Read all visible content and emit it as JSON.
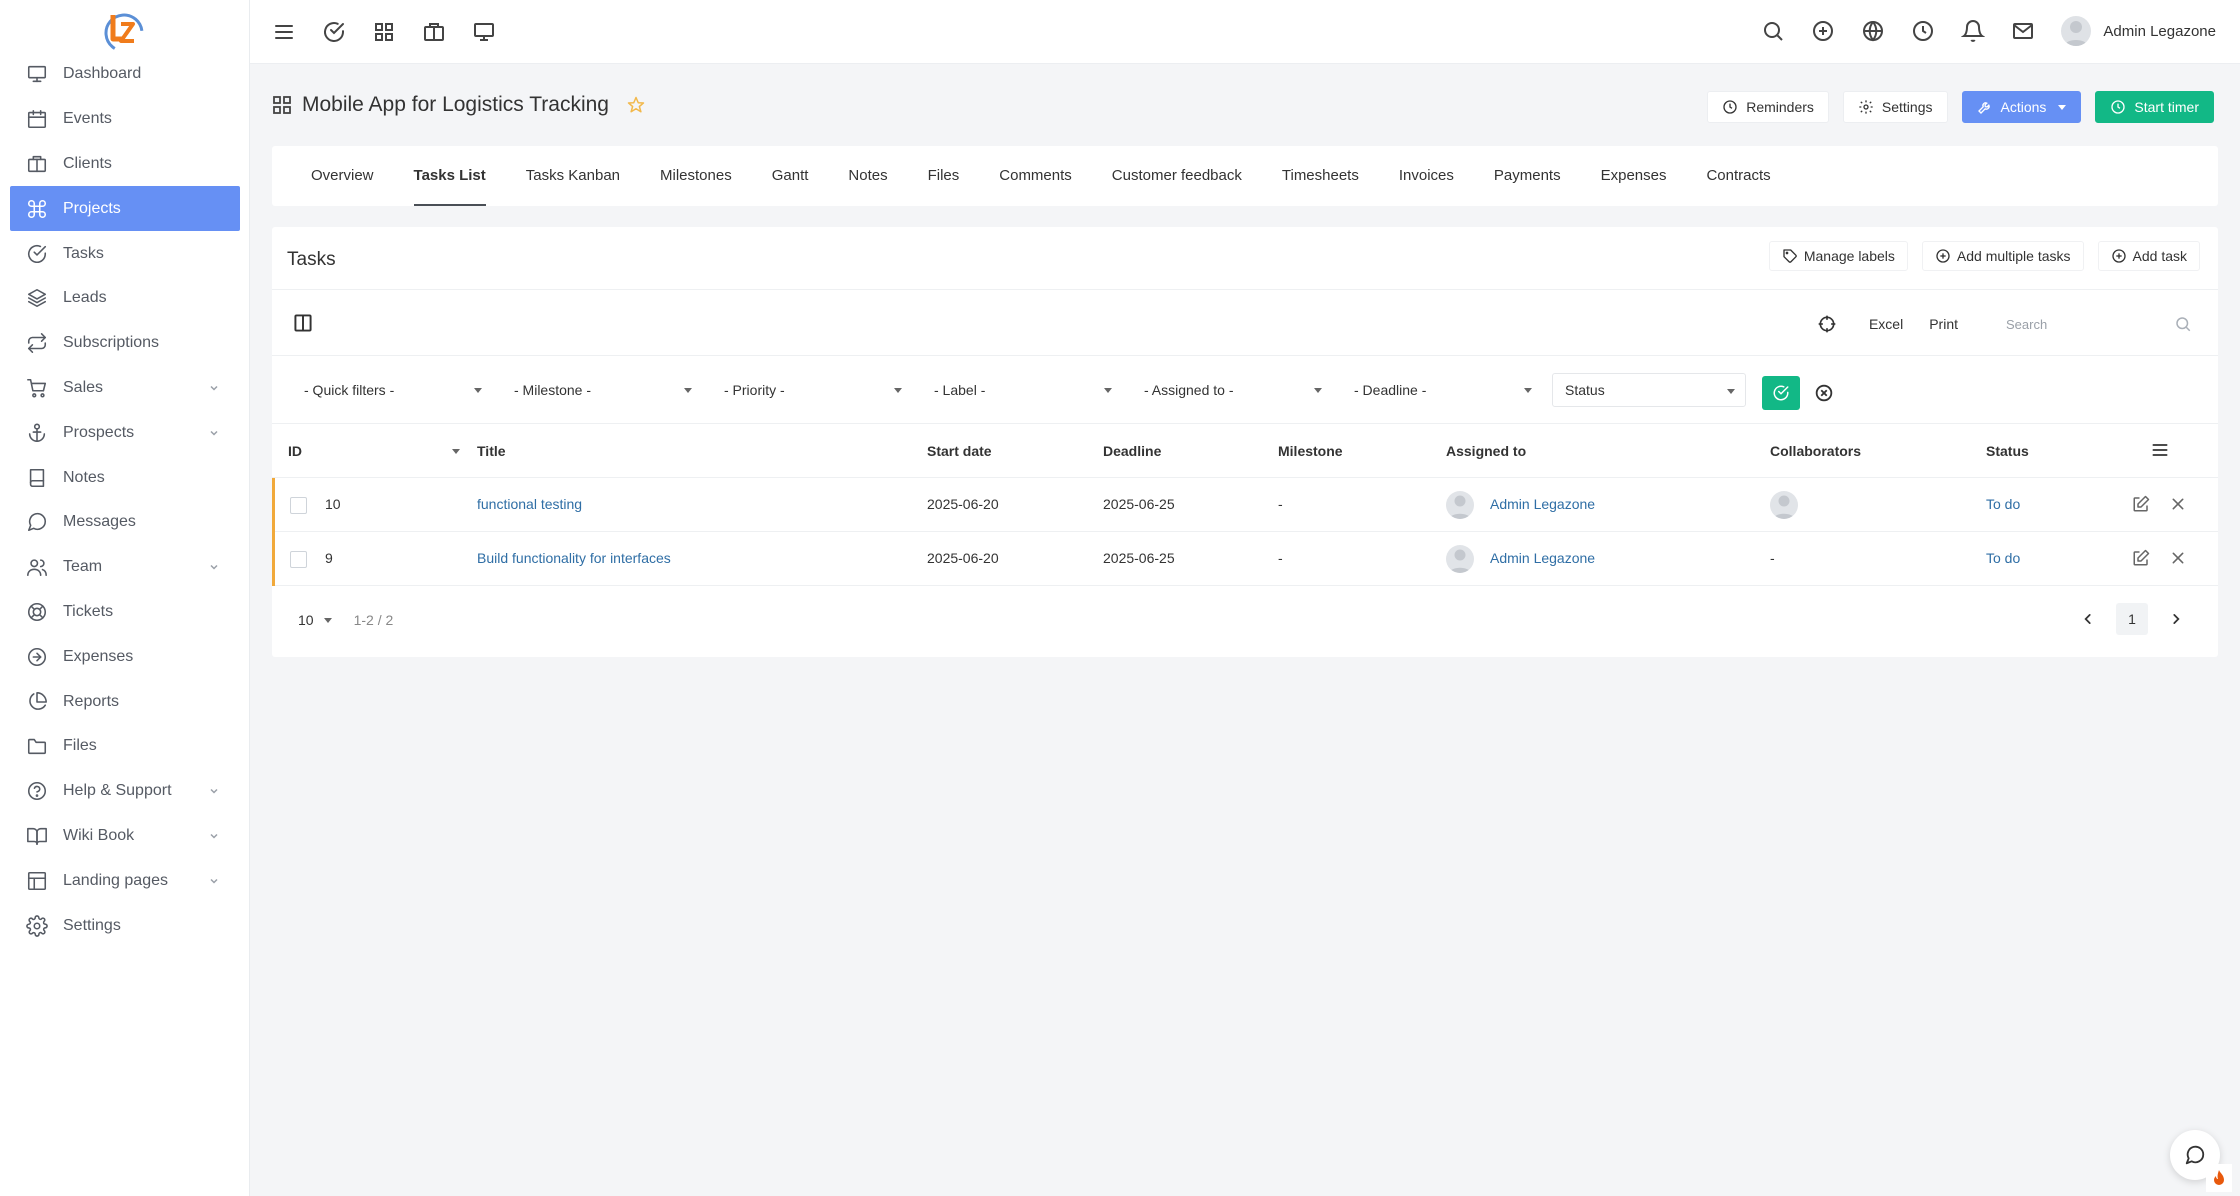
{
  "sidebar": {
    "items": [
      {
        "label": "Dashboard",
        "icon": "monitor-icon"
      },
      {
        "label": "Events",
        "icon": "calendar-icon"
      },
      {
        "label": "Clients",
        "icon": "briefcase-icon"
      },
      {
        "label": "Projects",
        "icon": "command-icon",
        "active": true
      },
      {
        "label": "Tasks",
        "icon": "check-circle-icon"
      },
      {
        "label": "Leads",
        "icon": "layers-icon"
      },
      {
        "label": "Subscriptions",
        "icon": "repeat-icon"
      },
      {
        "label": "Sales",
        "icon": "cart-icon",
        "has_submenu": true
      },
      {
        "label": "Prospects",
        "icon": "anchor-icon",
        "has_submenu": true
      },
      {
        "label": "Notes",
        "icon": "book-icon"
      },
      {
        "label": "Messages",
        "icon": "message-circle-icon"
      },
      {
        "label": "Team",
        "icon": "users-icon",
        "has_submenu": true
      },
      {
        "label": "Tickets",
        "icon": "life-buoy-icon"
      },
      {
        "label": "Expenses",
        "icon": "arrow-right-circle-icon"
      },
      {
        "label": "Reports",
        "icon": "pie-chart-icon"
      },
      {
        "label": "Files",
        "icon": "folder-icon"
      },
      {
        "label": "Help & Support",
        "icon": "help-circle-icon",
        "has_submenu": true
      },
      {
        "label": "Wiki Book",
        "icon": "book-open-icon",
        "has_submenu": true
      },
      {
        "label": "Landing pages",
        "icon": "layout-icon",
        "has_submenu": true
      },
      {
        "label": "Settings",
        "icon": "settings-icon"
      }
    ]
  },
  "topbar": {
    "user_name": "Admin Legazone"
  },
  "header": {
    "title": "Mobile App for Logistics Tracking",
    "reminders_label": "Reminders",
    "settings_label": "Settings",
    "actions_label": "Actions",
    "start_timer_label": "Start timer"
  },
  "tabs": [
    "Overview",
    "Tasks List",
    "Tasks Kanban",
    "Milestones",
    "Gantt",
    "Notes",
    "Files",
    "Comments",
    "Customer feedback",
    "Timesheets",
    "Invoices",
    "Payments",
    "Expenses",
    "Contracts"
  ],
  "active_tab": "Tasks List",
  "tasks": {
    "title": "Tasks",
    "manage_labels": "Manage labels",
    "add_multiple": "Add multiple tasks",
    "add_task": "Add task",
    "excel": "Excel",
    "print": "Print",
    "search_placeholder": "Search",
    "filters": {
      "quick": "- Quick filters -",
      "milestone": "- Milestone -",
      "priority": "- Priority -",
      "label": "- Label -",
      "assigned": "- Assigned to -",
      "deadline": "- Deadline -",
      "status": "Status"
    },
    "columns": {
      "id": "ID",
      "title": "Title",
      "start": "Start date",
      "deadline": "Deadline",
      "milestone": "Milestone",
      "assigned": "Assigned to",
      "collaborators": "Collaborators",
      "status": "Status"
    },
    "rows": [
      {
        "id": "10",
        "title": "functional testing",
        "start": "2025-06-20",
        "deadline": "2025-06-25",
        "milestone": "-",
        "assigned": "Admin Legazone",
        "collaborators": "",
        "status": "To do"
      },
      {
        "id": "9",
        "title": "Build functionality for interfaces",
        "start": "2025-06-20",
        "deadline": "2025-06-25",
        "milestone": "-",
        "assigned": "Admin Legazone",
        "collaborators": "-",
        "status": "To do"
      }
    ],
    "page_size": "10",
    "range": "1-2 / 2",
    "current_page": "1"
  },
  "colors": {
    "accent": "#6690f4",
    "success": "#12b886",
    "priority_bar": "#f1a93a",
    "link": "#2f6ea5"
  }
}
